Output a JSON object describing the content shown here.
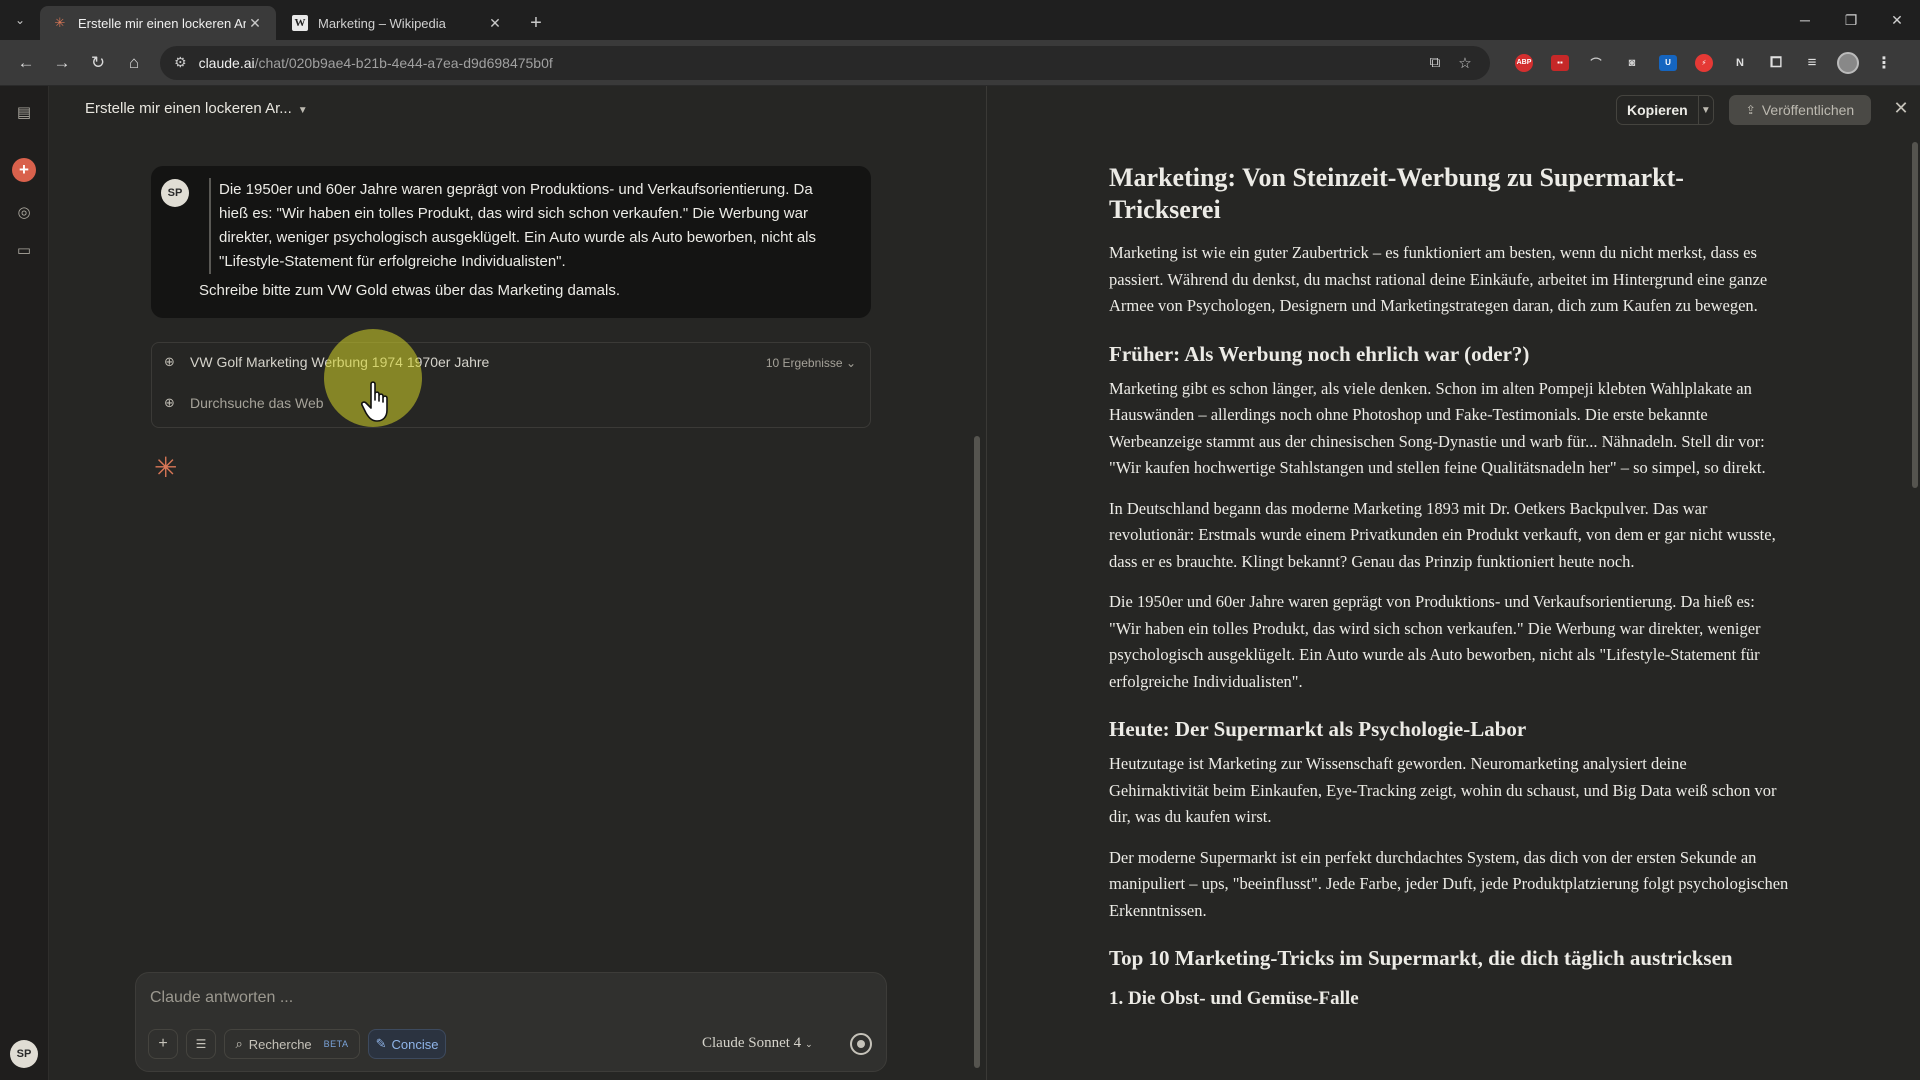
{
  "browser": {
    "tabs": [
      {
        "title": "Erstelle mir einen lockeren Ar...",
        "active": true,
        "icon": "claude-icon"
      },
      {
        "title": "Marketing – Wikipedia",
        "active": false,
        "icon": "wikipedia-icon"
      }
    ],
    "url_host": "claude.ai",
    "url_path": "/chat/020b9ae4-b21b-4e44-a7ea-d9d698475b0f",
    "extensions": [
      "ABP",
      "N"
    ]
  },
  "chat": {
    "title": "Erstelle mir einen lockeren Ar...",
    "user_initials": "SP",
    "quote_lines": [
      "Die 1950er und 60er Jahre waren geprägt von Produktions- und Verkaufsorientierung. Da",
      "hieß es: \"Wir haben ein tolles Produkt, das wird sich schon verkaufen.\" Die Werbung war",
      "direkter, weniger psychologisch ausgeklügelt. Ein Auto wurde als Auto beworben, nicht als",
      "\"Lifestyle-Statement für erfolgreiche Individualisten\"."
    ],
    "request": "Schreibe bitte zum VW Gold etwas über das Marketing damals.",
    "search_query": "VW Golf Marketing Werbung 1974 1970er Jahre",
    "search_results": "10 Ergebnisse",
    "search_status": "Durchsuche das Web",
    "composer_placeholder": "Claude antworten ...",
    "research_label": "Recherche",
    "beta_label": "BETA",
    "style_label": "Concise",
    "model_label": "Claude Sonnet 4"
  },
  "artifact": {
    "copy_label": "Kopieren",
    "publish_label": "Veröffentlichen",
    "title": "Marketing: Von Steinzeit-Werbung zu Supermarkt-Trickserei",
    "intro": "Marketing ist wie ein guter Zaubertrick – es funktioniert am besten, wenn du nicht merkst, dass es passiert. Während du denkst, du machst rational deine Einkäufe, arbeitet im Hintergrund eine ganze Armee von Psychologen, Designern und Marketingstrategen daran, dich zum Kaufen zu bewegen.",
    "h_frueher": "Früher: Als Werbung noch ehrlich war (oder?)",
    "p1": "Marketing gibt es schon länger, als viele denken. Schon im alten Pompeji klebten Wahlplakate an Hauswänden – allerdings noch ohne Photoshop und Fake-Testimonials. Die erste bekannte Werbeanzeige stammt aus der chinesischen Song-Dynastie und warb für... Nähnadeln. Stell dir vor: \"Wir kaufen hochwertige Stahlstangen und stellen feine Qualitätsnadeln her\" – so simpel, so direkt.",
    "p2": "In Deutschland begann das moderne Marketing 1893 mit Dr. Oetkers Backpulver. Das war revolutionär: Erstmals wurde einem Privatkunden ein Produkt verkauft, von dem er gar nicht wusste, dass er es brauchte. Klingt bekannt? Genau das Prinzip funktioniert heute noch.",
    "p3": "Die 1950er und 60er Jahre waren geprägt von Produktions- und Verkaufsorientierung. Da hieß es: \"Wir haben ein tolles Produkt, das wird sich schon verkaufen.\" Die Werbung war direkter, weniger psychologisch ausgeklügelt. Ein Auto wurde als Auto beworben, nicht als \"Lifestyle-Statement für erfolgreiche Individualisten\".",
    "h_heute": "Heute: Der Supermarkt als Psychologie-Labor",
    "p4": "Heutzutage ist Marketing zur Wissenschaft geworden. Neuromarketing analysiert deine Gehirnaktivität beim Einkaufen, Eye-Tracking zeigt, wohin du schaust, und Big Data weiß schon vor dir, was du kaufen wirst.",
    "p5": "Der moderne Supermarkt ist ein perfekt durchdachtes System, das dich von der ersten Sekunde an manipuliert – ups, \"beeinflusst\". Jede Farbe, jeder Duft, jede Produktplatzierung folgt psychologischen Erkenntnissen.",
    "h_top10": "Top 10 Marketing-Tricks im Supermarkt, die dich täglich austricksen",
    "h_obst": "1. Die Obst- und Gemüse-Falle"
  },
  "colors": {
    "accent": "#d97757",
    "background": "#262624",
    "user_bubble": "#141413"
  }
}
